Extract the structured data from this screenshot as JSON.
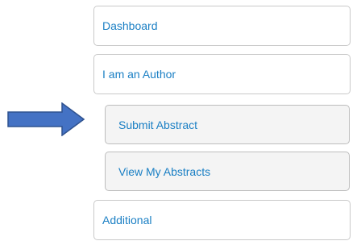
{
  "nav": {
    "items": [
      {
        "label": "Dashboard"
      },
      {
        "label": "I am an Author"
      },
      {
        "label": "Submit Abstract"
      },
      {
        "label": "View My Abstracts"
      },
      {
        "label": "Additional"
      }
    ]
  },
  "annotation": {
    "icon": "right-arrow-icon",
    "color": "#4472c4",
    "outline": "#2f528f"
  },
  "colors": {
    "link": "#1a7fc4",
    "border": "#c9c9c9",
    "sub_background": "#f4f4f4"
  }
}
